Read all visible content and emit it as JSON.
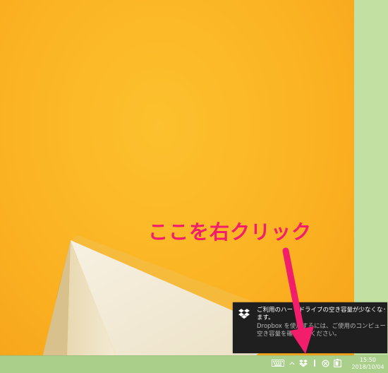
{
  "annotation": {
    "text": "ここを右クリック",
    "color": "#f21e6b"
  },
  "notification": {
    "app_icon": "dropbox-icon",
    "line1": "ご利用のハードドライブの空き容量が少なくなってい",
    "line2": "ます。",
    "line3": "Dropbox を使用するには、ご使用のコンピュータの",
    "line4": "空き容量を確保してください。"
  },
  "taskbar": {
    "tray_icons": [
      "keyboard-icon",
      "chevron-up-icon",
      "dropbox-icon",
      "network-icon",
      "no-sound-icon",
      "battery-icon"
    ],
    "clock": {
      "time": "15:50",
      "date": "2018/10/04"
    }
  },
  "colors": {
    "wallpaper": "#fbb323",
    "side_panel": "#c2e0a2",
    "taskbar": "#a9cf8a",
    "toast_bg": "#1f1f1f",
    "arrow": "#f21e6b"
  }
}
